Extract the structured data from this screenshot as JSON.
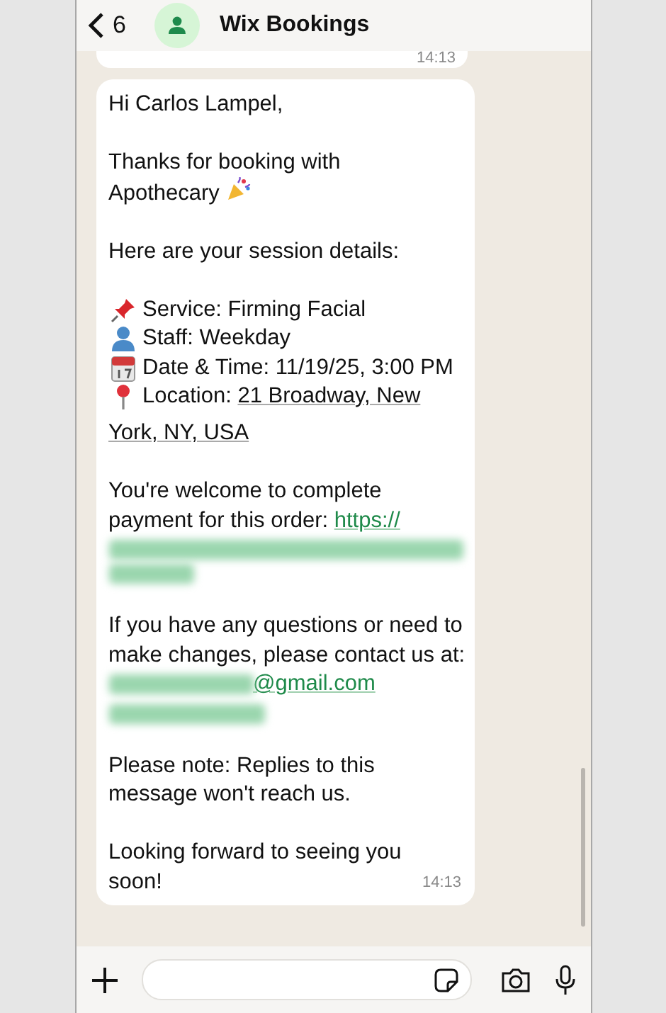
{
  "header": {
    "back_count": "6",
    "title": "Wix Bookings"
  },
  "previous_message": {
    "time": "14:13"
  },
  "message": {
    "blocks": [
      {
        "kind": "text",
        "text": "Hi Carlos Lampel,"
      },
      {
        "kind": "celebration",
        "lines": [
          "Thanks for booking with",
          "Apothecary"
        ]
      },
      {
        "kind": "details",
        "intro": "Here are your session details:",
        "items": [
          {
            "kind": "service",
            "text": "Service: Firming Facial"
          },
          {
            "kind": "staff",
            "text": "Staff: Weekday"
          },
          {
            "kind": "datetime",
            "text": "Date & Time: 11/19/25, 3:00 PM"
          },
          {
            "kind": "location",
            "text": "Location:",
            "link_lines": [
              "21 Broadway, New",
              "York, NY, USA"
            ]
          }
        ]
      },
      {
        "kind": "payment",
        "text": "You're welcome to complete payment for this order: ",
        "link": "https://"
      },
      {
        "kind": "contact",
        "text": "If you have any questions or need to make changes, please contact us at:",
        "link": "@gmail.com"
      },
      {
        "kind": "text",
        "text": "Please note: Replies to this message won't reach us."
      },
      {
        "kind": "text",
        "text": "Looking forward to seeing you soon!"
      }
    ],
    "time": "14:13"
  }
}
